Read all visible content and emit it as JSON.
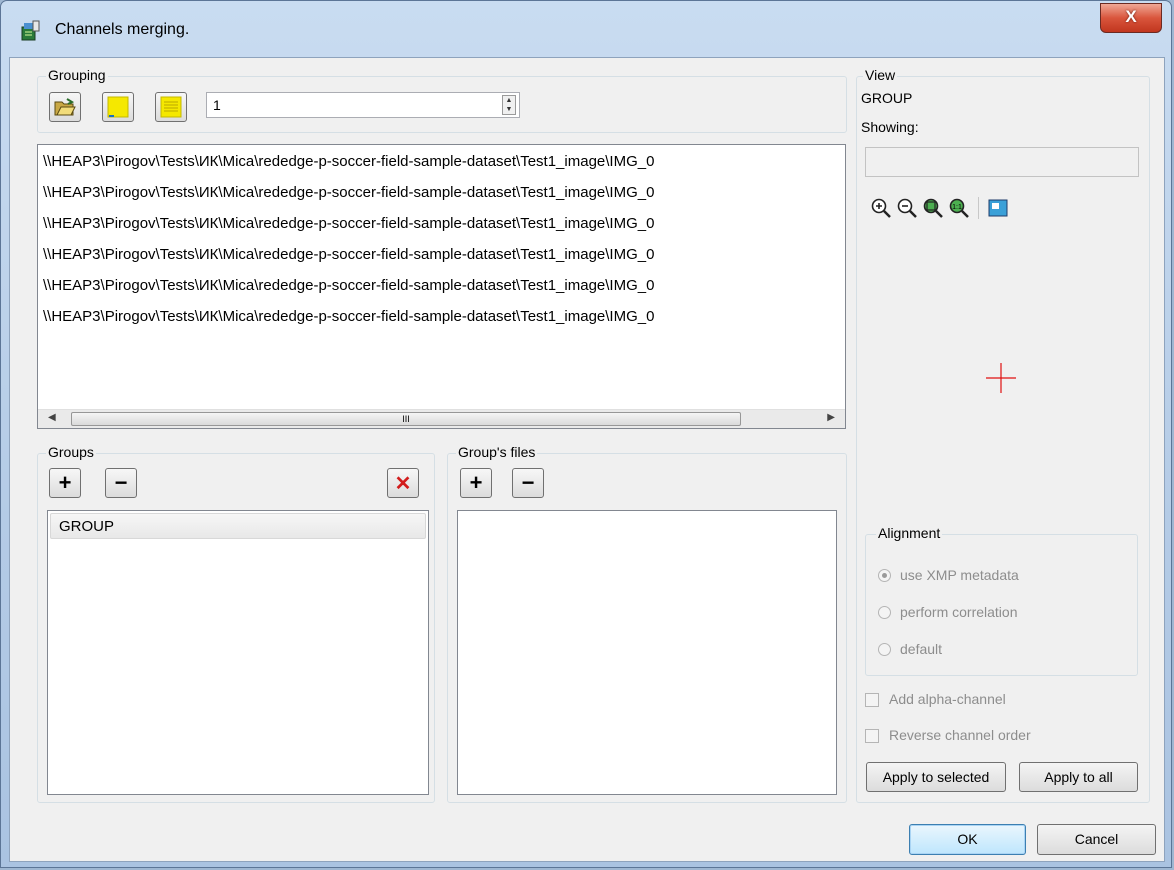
{
  "window": {
    "title": "Channels merging.",
    "close_glyph": "X"
  },
  "grouping": {
    "title": "Grouping",
    "spin_value": "1",
    "files": [
      "\\\\HEAP3\\Pirogov\\Tests\\ИК\\Mica\\rededge-p-soccer-field-sample-dataset\\Test1_image\\IMG_0",
      "\\\\HEAP3\\Pirogov\\Tests\\ИК\\Mica\\rededge-p-soccer-field-sample-dataset\\Test1_image\\IMG_0",
      "\\\\HEAP3\\Pirogov\\Tests\\ИК\\Mica\\rededge-p-soccer-field-sample-dataset\\Test1_image\\IMG_0",
      "\\\\HEAP3\\Pirogov\\Tests\\ИК\\Mica\\rededge-p-soccer-field-sample-dataset\\Test1_image\\IMG_0",
      "\\\\HEAP3\\Pirogov\\Tests\\ИК\\Mica\\rededge-p-soccer-field-sample-dataset\\Test1_image\\IMG_0",
      "\\\\HEAP3\\Pirogov\\Tests\\ИК\\Mica\\rededge-p-soccer-field-sample-dataset\\Test1_image\\IMG_0"
    ],
    "scroll_thumb_glyph": "III"
  },
  "groups": {
    "title": "Groups",
    "items": [
      "GROUP"
    ],
    "add_glyph": "+",
    "remove_glyph": "−",
    "delete_glyph": "✕"
  },
  "group_files": {
    "title": "Group's files",
    "add_glyph": "+",
    "remove_glyph": "−"
  },
  "view": {
    "title": "View",
    "group_name": "GROUP",
    "showing_label": "Showing:",
    "showing_value": ""
  },
  "alignment": {
    "title": "Alignment",
    "options": [
      "use XMP metadata",
      "perform correlation",
      "default"
    ],
    "selected": "use XMP metadata"
  },
  "checkboxes": {
    "alpha": "Add alpha-channel",
    "reverse": "Reverse channel order"
  },
  "buttons": {
    "apply_selected": "Apply to selected",
    "apply_all": "Apply to all",
    "ok": "OK",
    "cancel": "Cancel"
  },
  "colors": {
    "accent_yellow": "#f5e800",
    "crosshair": "#e01010",
    "delete_red": "#d21c1c"
  }
}
